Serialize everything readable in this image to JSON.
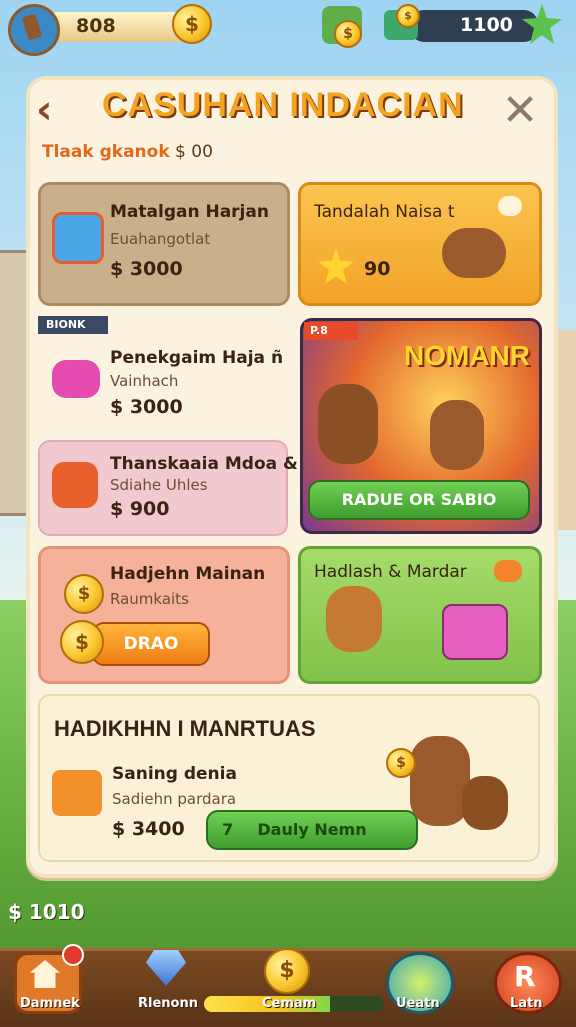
{
  "hud": {
    "coins_left": "808",
    "coins_right": "1100"
  },
  "header": {
    "title": "CASUHAN INDACIAN",
    "subtitle_text": "Tlaak gkanok",
    "subtitle_value": "$ 00",
    "back_icon": "back-arrow-icon",
    "close_icon": "close-icon"
  },
  "cards": {
    "card1": {
      "name": "Matalgan Harjan",
      "sub": "Euahangotlat",
      "price": "$ 3000"
    },
    "card2": {
      "name": "Tandalah Naisa t",
      "value": "90"
    },
    "card3": {
      "badge": "BIONK",
      "name": "Penekgaim Haja ñ",
      "sub": "Vainhach",
      "price": "$ 3000"
    },
    "promo": {
      "badge": "P.8",
      "title": "NOMANR",
      "button": "RADUE OR SABIO"
    },
    "card4": {
      "name": "Thanskaaia Mdoa &",
      "sub": "Sdiahe Uhles",
      "price": "$ 900"
    },
    "card5": {
      "name": "Hadjehn Mainan",
      "sub": "Raumkaits",
      "button": "DRAO"
    },
    "card6": {
      "name": "Hadlash & Mardar"
    }
  },
  "bottom_card": {
    "title": "HADIKHHN I MANRTUAS",
    "name": "Saning denia",
    "sub": "Sadiehn pardara",
    "price": "$ 3400",
    "button_num": "7",
    "button_label": "Dauly Nemn"
  },
  "float_money": "$ 1010",
  "nav": {
    "home": "Damnek",
    "items": "Rlenonn",
    "center": "Cemam",
    "chat": "Ueatn",
    "right": "Latn",
    "progress": 0.7
  },
  "colors": {
    "title": "#f2a321",
    "green_button": "#4fb43a",
    "orange_button": "#f39420"
  }
}
